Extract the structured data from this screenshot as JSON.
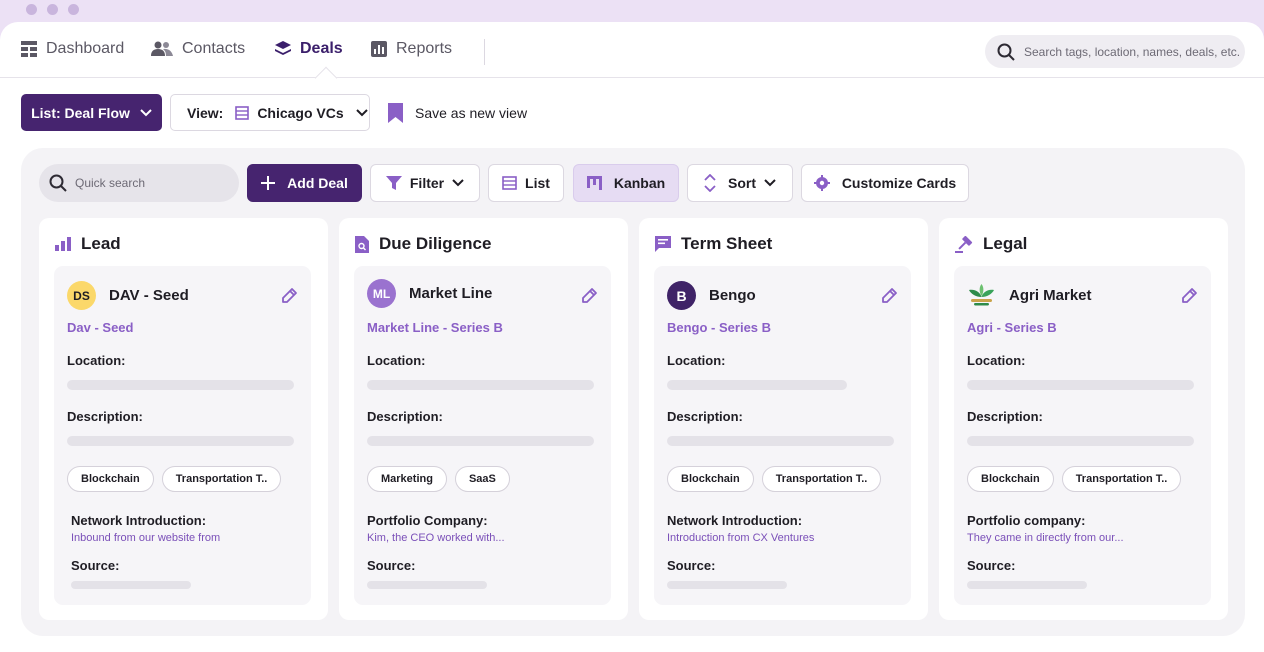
{
  "colors": {
    "accent": "#46246f",
    "accent_light": "#8a5fc6",
    "window_frame": "#ece1f5"
  },
  "nav": {
    "items": [
      {
        "label": "Dashboard",
        "icon": "grid-icon",
        "active": false
      },
      {
        "label": "Contacts",
        "icon": "users-icon",
        "active": false
      },
      {
        "label": "Deals",
        "icon": "layers-icon",
        "active": true
      },
      {
        "label": "Reports",
        "icon": "bar-chart-icon",
        "active": false
      }
    ],
    "search_placeholder": "Search tags, location, names, deals, etc."
  },
  "toolbar": {
    "list_label": "List: Deal Flow",
    "view_prefix": "View:",
    "view_value": "Chicago VCs",
    "save_label": "Save as new view"
  },
  "board_toolbar": {
    "quick_search_placeholder": "Quick search",
    "add_deal": "Add Deal",
    "filter": "Filter",
    "list": "List",
    "kanban": "Kanban",
    "sort": "Sort",
    "customize": "Customize Cards"
  },
  "columns": [
    {
      "title": "Lead",
      "icon": "bar-chart-icon",
      "card": {
        "avatar_text": "DS",
        "avatar_bg": "#fbd86a",
        "avatar_fg": "#1f1d24",
        "name": "DAV - Seed",
        "subtitle": "Dav - Seed",
        "location_label": "Location:",
        "description_label": "Description:",
        "tags": [
          "Blockchain",
          "Transportation T.."
        ],
        "intro_label": "Network Introduction:",
        "intro_text": "Inbound from our website from",
        "source_label": "Source:"
      }
    },
    {
      "title": "Due Diligence",
      "icon": "document-search-icon",
      "card": {
        "avatar_text": "ML",
        "avatar_bg": "#9a72cf",
        "avatar_fg": "#ffffff",
        "name": "Market Line",
        "subtitle": "Market Line - Series B",
        "location_label": "Location:",
        "description_label": "Description:",
        "tags": [
          "Marketing",
          "SaaS"
        ],
        "intro_label": "Portfolio Company:",
        "intro_text": "Kim, the CEO worked with...",
        "source_label": "Source:"
      }
    },
    {
      "title": "Term Sheet",
      "icon": "message-icon",
      "card": {
        "avatar_text": "B",
        "avatar_bg": "#3f2367",
        "avatar_fg": "#ffffff",
        "name": "Bengo",
        "subtitle": "Bengo - Series B",
        "location_label": "Location:",
        "description_label": "Description:",
        "tags": [
          "Blockchain",
          "Transportation T.."
        ],
        "intro_label": "Network Introduction:",
        "intro_text": "Introduction from CX Ventures",
        "source_label": "Source:"
      }
    },
    {
      "title": "Legal",
      "icon": "gavel-icon",
      "card": {
        "avatar_text": "",
        "avatar_bg": "#ffffff",
        "avatar_fg": "#2e8b4a",
        "name": "Agri Market",
        "subtitle": "Agri - Series B",
        "location_label": "Location:",
        "description_label": "Description:",
        "tags": [
          "Blockchain",
          "Transportation T.."
        ],
        "intro_label": "Portfolio company:",
        "intro_text": "They came in directly from our...",
        "source_label": "Source:"
      }
    }
  ]
}
